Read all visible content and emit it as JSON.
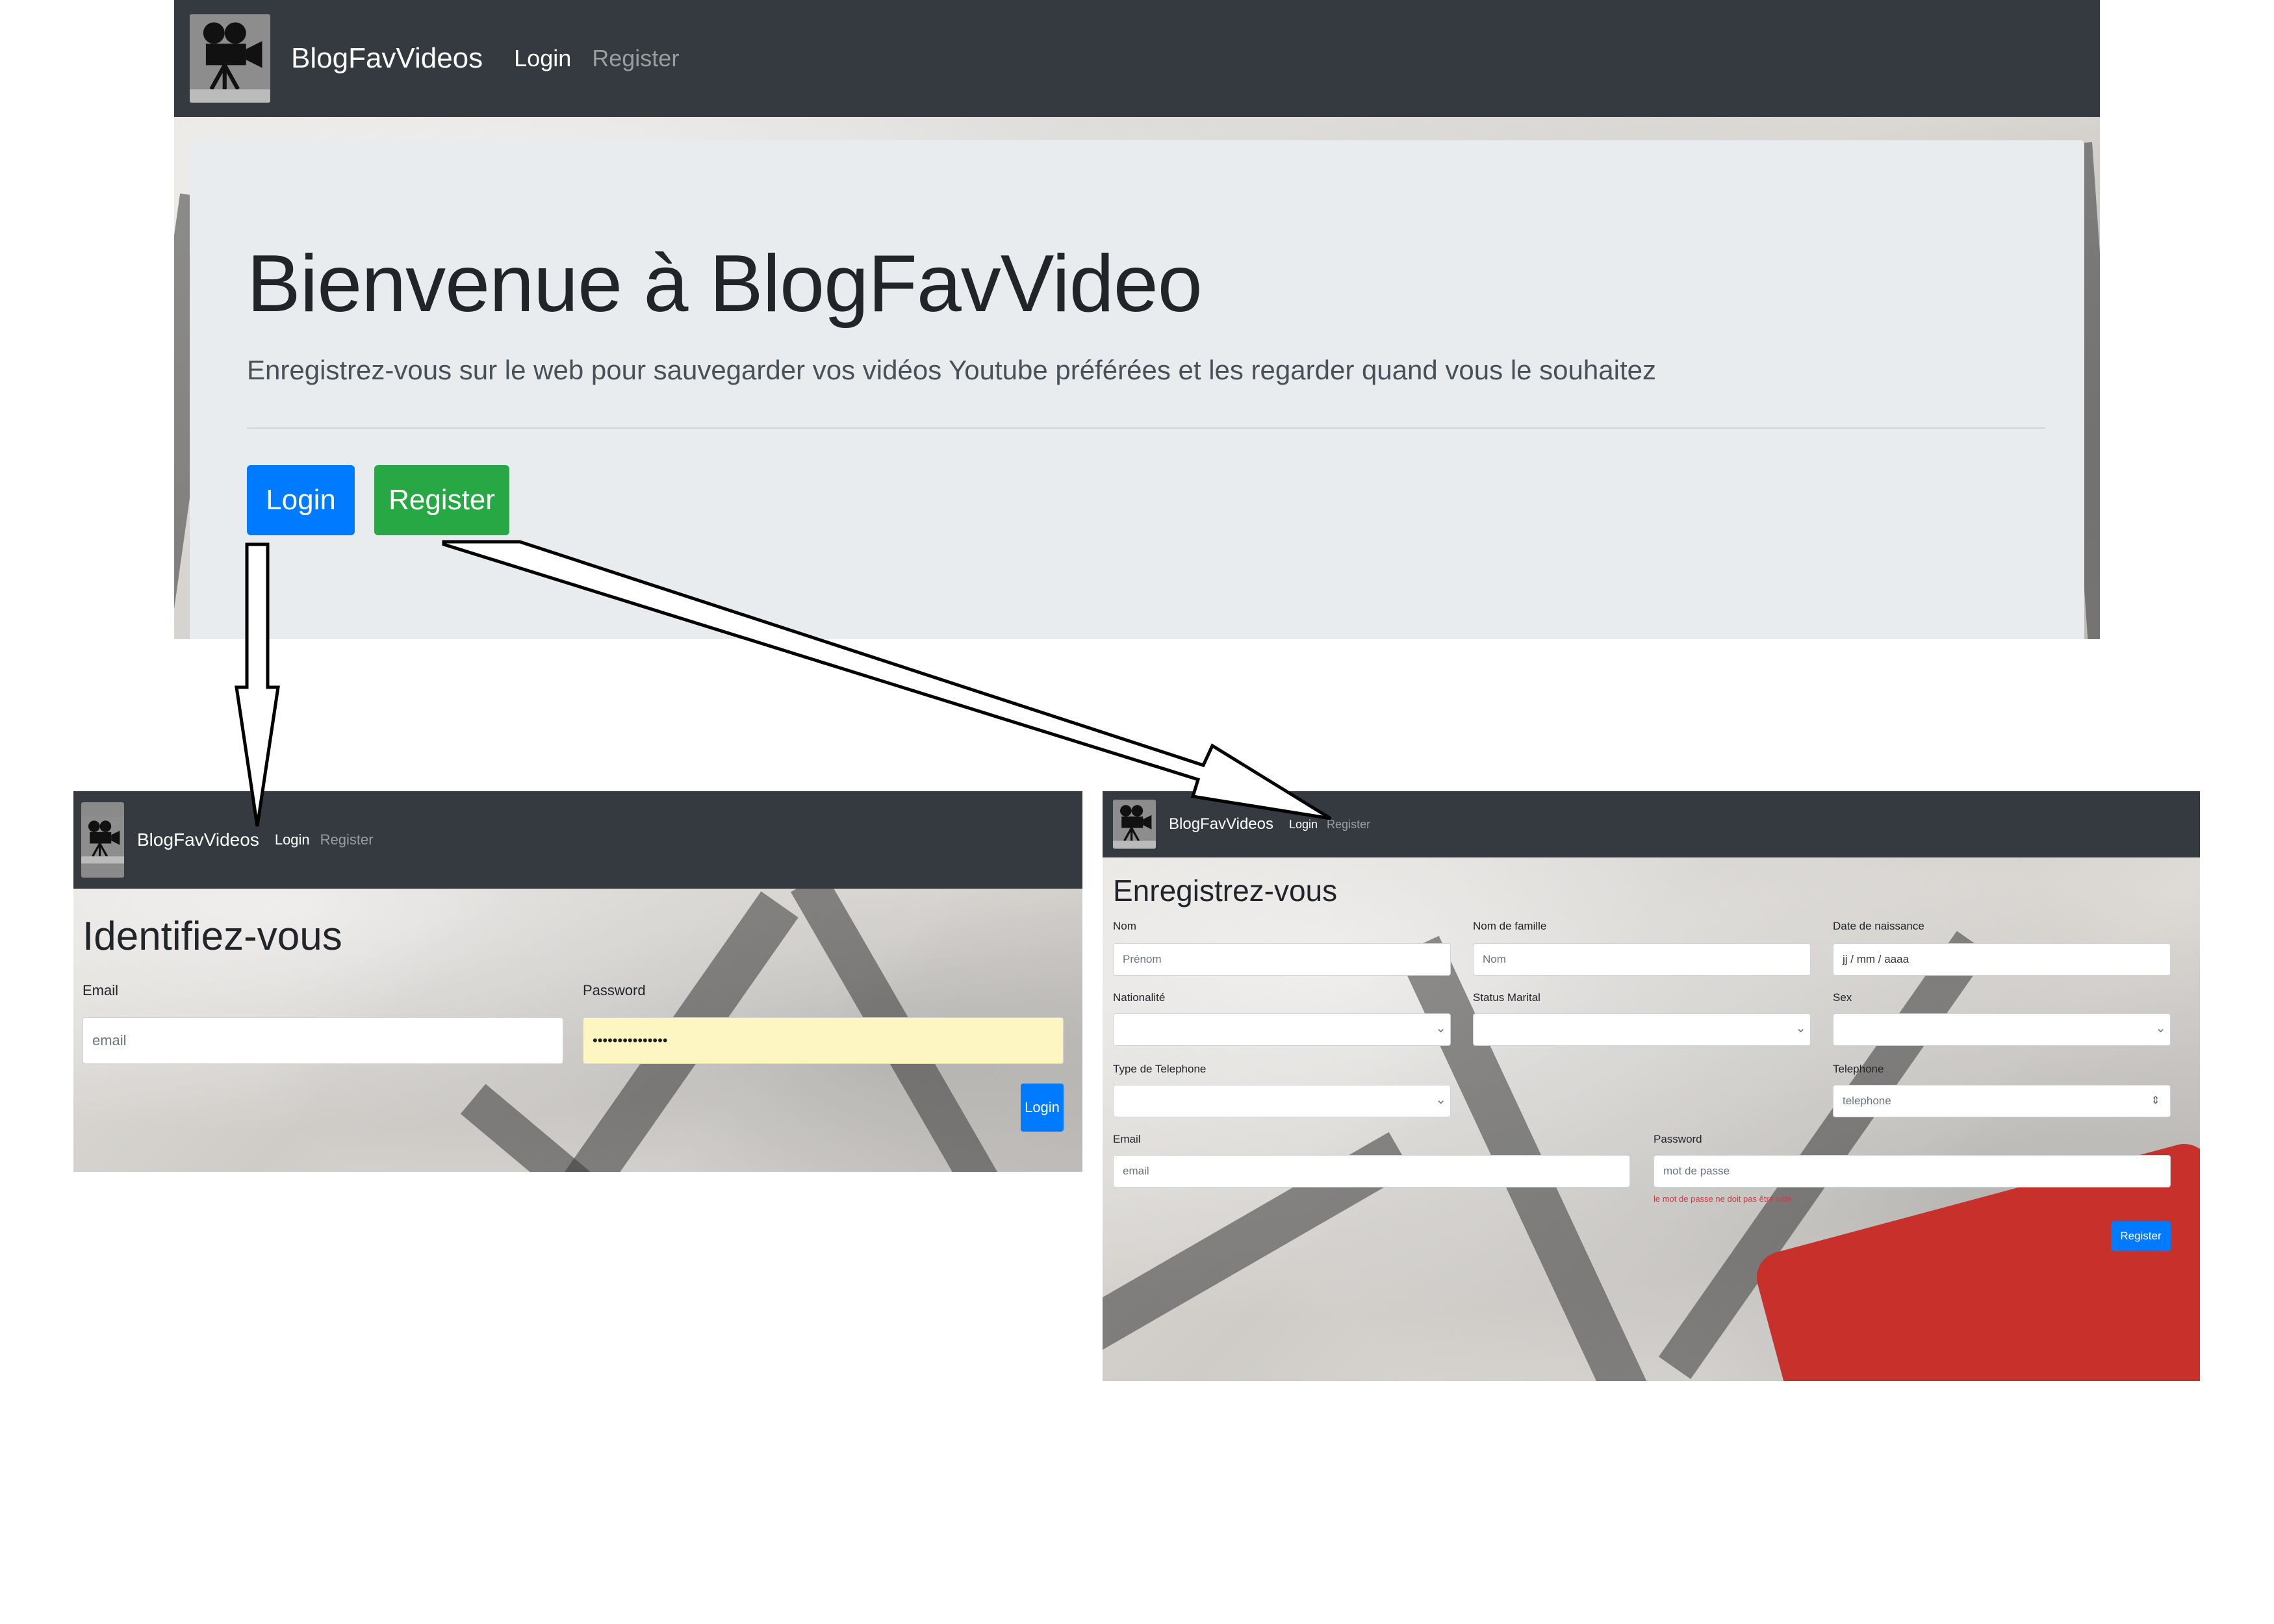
{
  "brand": {
    "name": "BlogFavVideos",
    "logo_icon": "film-camera-icon"
  },
  "nav": {
    "login": "Login",
    "register": "Register"
  },
  "home": {
    "title": "Bienvenue à BlogFavVideo",
    "lead": "Enregistrez-vous sur le web pour sauvegarder vos vidéos Youtube préférées et les regarder quand vous le souhaitez",
    "login_button": "Login",
    "register_button": "Register"
  },
  "login_page": {
    "title": "Identifiez-vous",
    "email_label": "Email",
    "email_placeholder": "email",
    "password_label": "Password",
    "password_value": "•••••••••••••••",
    "submit": "Login"
  },
  "register_page": {
    "title": "Enregistrez-vous",
    "nom_label": "Nom",
    "nom_placeholder": "Prénom",
    "nom_famille_label": "Nom de famille",
    "nom_famille_placeholder": "Nom",
    "date_label": "Date de naissance",
    "date_placeholder": "jj / mm / aaaa",
    "nationalite_label": "Nationalité",
    "status_label": "Status Marital",
    "sex_label": "Sex",
    "type_tel_label": "Type de Telephone",
    "telephone_label": "Telephone",
    "telephone_placeholder": "telephone",
    "email_label": "Email",
    "email_placeholder": "email",
    "password_label": "Password",
    "password_placeholder": "mot de passe",
    "password_error": "le mot de passe ne doit pas être vide",
    "submit": "Register"
  },
  "colors": {
    "navbar": "#343a40",
    "primary": "#007bff",
    "success": "#28a745",
    "jumbotron": "#e9ecef",
    "error": "#dc3545"
  }
}
